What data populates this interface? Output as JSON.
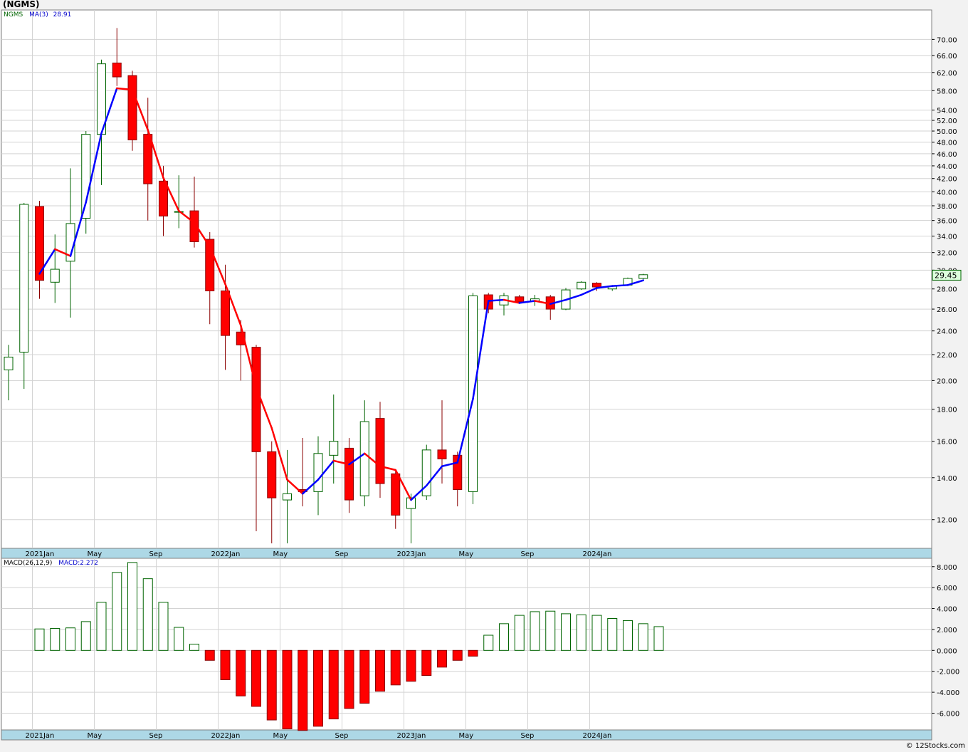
{
  "title": "(NGMS)",
  "footer": "© 12Stocks.com",
  "colors": {
    "up_fill": "#ffffff",
    "up_stroke": "#006400",
    "down_fill": "#ff0000",
    "down_stroke": "#8b0000",
    "ma_up": "#0000ff",
    "ma_down": "#ff0000",
    "axis_band": "#add8e6",
    "grid": "#d3d3d3"
  },
  "chart_data": [
    {
      "type": "candlestick",
      "symbol": "NGMS",
      "scale": "log",
      "legend": {
        "symbol": "NGMS",
        "ma_label": "MA(3)",
        "ma_value": "28.91"
      },
      "last_price": "29.45",
      "x_ticks": [
        "2021Jan",
        "May",
        "Sep",
        "2022Jan",
        "May",
        "Sep",
        "2023Jan",
        "May",
        "Sep",
        "2024Jan"
      ],
      "y_ticks": [
        "70.00",
        "66.00",
        "62.00",
        "58.00",
        "54.00",
        "52.00",
        "50.00",
        "48.00",
        "46.00",
        "44.00",
        "42.00",
        "40.00",
        "38.00",
        "36.00",
        "34.00",
        "32.00",
        "30.00",
        "28.00",
        "26.00",
        "24.00",
        "22.00",
        "20.00",
        "18.00",
        "16.00",
        "14.00",
        "12.00"
      ],
      "ylim": [
        10.8,
        78
      ],
      "candles": [
        {
          "o": 20.8,
          "h": 22.8,
          "l": 18.6,
          "c": 21.8
        },
        {
          "o": 22.2,
          "h": 38.4,
          "l": 19.4,
          "c": 38.2
        },
        {
          "o": 37.9,
          "h": 38.7,
          "l": 27.0,
          "c": 28.9
        },
        {
          "o": 28.7,
          "h": 34.2,
          "l": 26.6,
          "c": 30.1
        },
        {
          "o": 31.0,
          "h": 43.6,
          "l": 25.2,
          "c": 35.6
        },
        {
          "o": 36.3,
          "h": 50.0,
          "l": 34.3,
          "c": 49.4
        },
        {
          "o": 49.4,
          "h": 65.0,
          "l": 41.0,
          "c": 64.0
        },
        {
          "o": 64.2,
          "h": 73.0,
          "l": 59.0,
          "c": 61.0
        },
        {
          "o": 61.3,
          "h": 62.4,
          "l": 46.5,
          "c": 48.4
        },
        {
          "o": 49.4,
          "h": 56.5,
          "l": 36.0,
          "c": 41.2
        },
        {
          "o": 41.6,
          "h": 44.0,
          "l": 34.0,
          "c": 36.6
        },
        {
          "o": 37.2,
          "h": 42.5,
          "l": 35.0,
          "c": 37.2
        },
        {
          "o": 37.3,
          "h": 42.3,
          "l": 32.6,
          "c": 33.3
        },
        {
          "o": 33.6,
          "h": 34.5,
          "l": 24.6,
          "c": 27.8
        },
        {
          "o": 27.8,
          "h": 30.6,
          "l": 20.8,
          "c": 23.6
        },
        {
          "o": 23.9,
          "h": 25.0,
          "l": 20.0,
          "c": 22.8
        },
        {
          "o": 22.6,
          "h": 22.8,
          "l": 11.5,
          "c": 15.4
        },
        {
          "o": 15.4,
          "h": 16.0,
          "l": 11.0,
          "c": 13.0
        },
        {
          "o": 12.9,
          "h": 15.5,
          "l": 11.0,
          "c": 13.2
        },
        {
          "o": 13.4,
          "h": 16.2,
          "l": 12.6,
          "c": 13.3
        },
        {
          "o": 13.3,
          "h": 16.3,
          "l": 12.2,
          "c": 15.3
        },
        {
          "o": 15.2,
          "h": 19.0,
          "l": 13.7,
          "c": 16.0
        },
        {
          "o": 15.6,
          "h": 16.2,
          "l": 12.3,
          "c": 12.9
        },
        {
          "o": 13.1,
          "h": 18.6,
          "l": 12.6,
          "c": 17.2
        },
        {
          "o": 17.4,
          "h": 18.5,
          "l": 13.0,
          "c": 13.7
        },
        {
          "o": 14.2,
          "h": 14.4,
          "l": 11.6,
          "c": 12.2
        },
        {
          "o": 12.5,
          "h": 13.2,
          "l": 11.0,
          "c": 13.0
        },
        {
          "o": 13.1,
          "h": 15.8,
          "l": 12.9,
          "c": 15.5
        },
        {
          "o": 15.5,
          "h": 18.6,
          "l": 13.7,
          "c": 15.0
        },
        {
          "o": 15.2,
          "h": 15.4,
          "l": 12.6,
          "c": 13.4
        },
        {
          "o": 13.3,
          "h": 27.6,
          "l": 12.7,
          "c": 27.3
        },
        {
          "o": 27.4,
          "h": 27.6,
          "l": 25.6,
          "c": 26.0
        },
        {
          "o": 26.4,
          "h": 27.6,
          "l": 25.4,
          "c": 27.3
        },
        {
          "o": 27.2,
          "h": 27.4,
          "l": 26.5,
          "c": 26.7
        },
        {
          "o": 26.8,
          "h": 27.4,
          "l": 26.3,
          "c": 27.0
        },
        {
          "o": 27.2,
          "h": 27.4,
          "l": 25.0,
          "c": 26.0
        },
        {
          "o": 26.0,
          "h": 28.1,
          "l": 25.9,
          "c": 27.9
        },
        {
          "o": 28.0,
          "h": 28.8,
          "l": 27.9,
          "c": 28.7
        },
        {
          "o": 28.6,
          "h": 28.7,
          "l": 27.8,
          "c": 28.2
        },
        {
          "o": 28.0,
          "h": 28.4,
          "l": 27.8,
          "c": 28.3
        },
        {
          "o": 28.4,
          "h": 29.2,
          "l": 28.3,
          "c": 29.1
        },
        {
          "o": 29.1,
          "h": 29.6,
          "l": 29.0,
          "c": 29.5
        }
      ],
      "ma_values": [
        null,
        null,
        29.6,
        32.4,
        31.6,
        38.5,
        49.6,
        58.5,
        58.2,
        50.2,
        42.1,
        37.3,
        35.7,
        32.7,
        28.5,
        24.5,
        19.5,
        16.8,
        13.9,
        13.2,
        13.9,
        14.9,
        14.7,
        15.3,
        14.6,
        14.4,
        12.9,
        13.6,
        14.6,
        14.8,
        18.7,
        26.8,
        26.9,
        26.6,
        26.8,
        26.5,
        26.9,
        27.4,
        28.1,
        28.3,
        28.4,
        28.9
      ]
    },
    {
      "type": "bar",
      "legend": {
        "label": "MACD(26,12,9)",
        "value_label": "MACD:2.272"
      },
      "y_ticks": [
        "8.000",
        "6.000",
        "4.000",
        "2.000",
        "0.000",
        "-2.000",
        "-4.000",
        "-6.000"
      ],
      "ylim": [
        -7.6,
        8.8
      ],
      "x_ticks": [
        "2021Jan",
        "May",
        "Sep",
        "2022Jan",
        "May",
        "Sep",
        "2023Jan",
        "May",
        "Sep",
        "2024Jan"
      ],
      "values": [
        null,
        null,
        2.05,
        2.1,
        2.15,
        2.75,
        4.6,
        7.45,
        8.4,
        6.85,
        4.6,
        2.2,
        0.6,
        -0.95,
        -2.8,
        -4.35,
        -5.35,
        -6.65,
        -7.5,
        -7.65,
        -7.25,
        -6.55,
        -5.55,
        -5.05,
        -3.9,
        -3.3,
        -2.95,
        -2.4,
        -1.6,
        -0.95,
        -0.55,
        1.45,
        2.55,
        3.35,
        3.7,
        3.75,
        3.5,
        3.4,
        3.35,
        3.05,
        2.85,
        2.55,
        2.27
      ]
    }
  ]
}
